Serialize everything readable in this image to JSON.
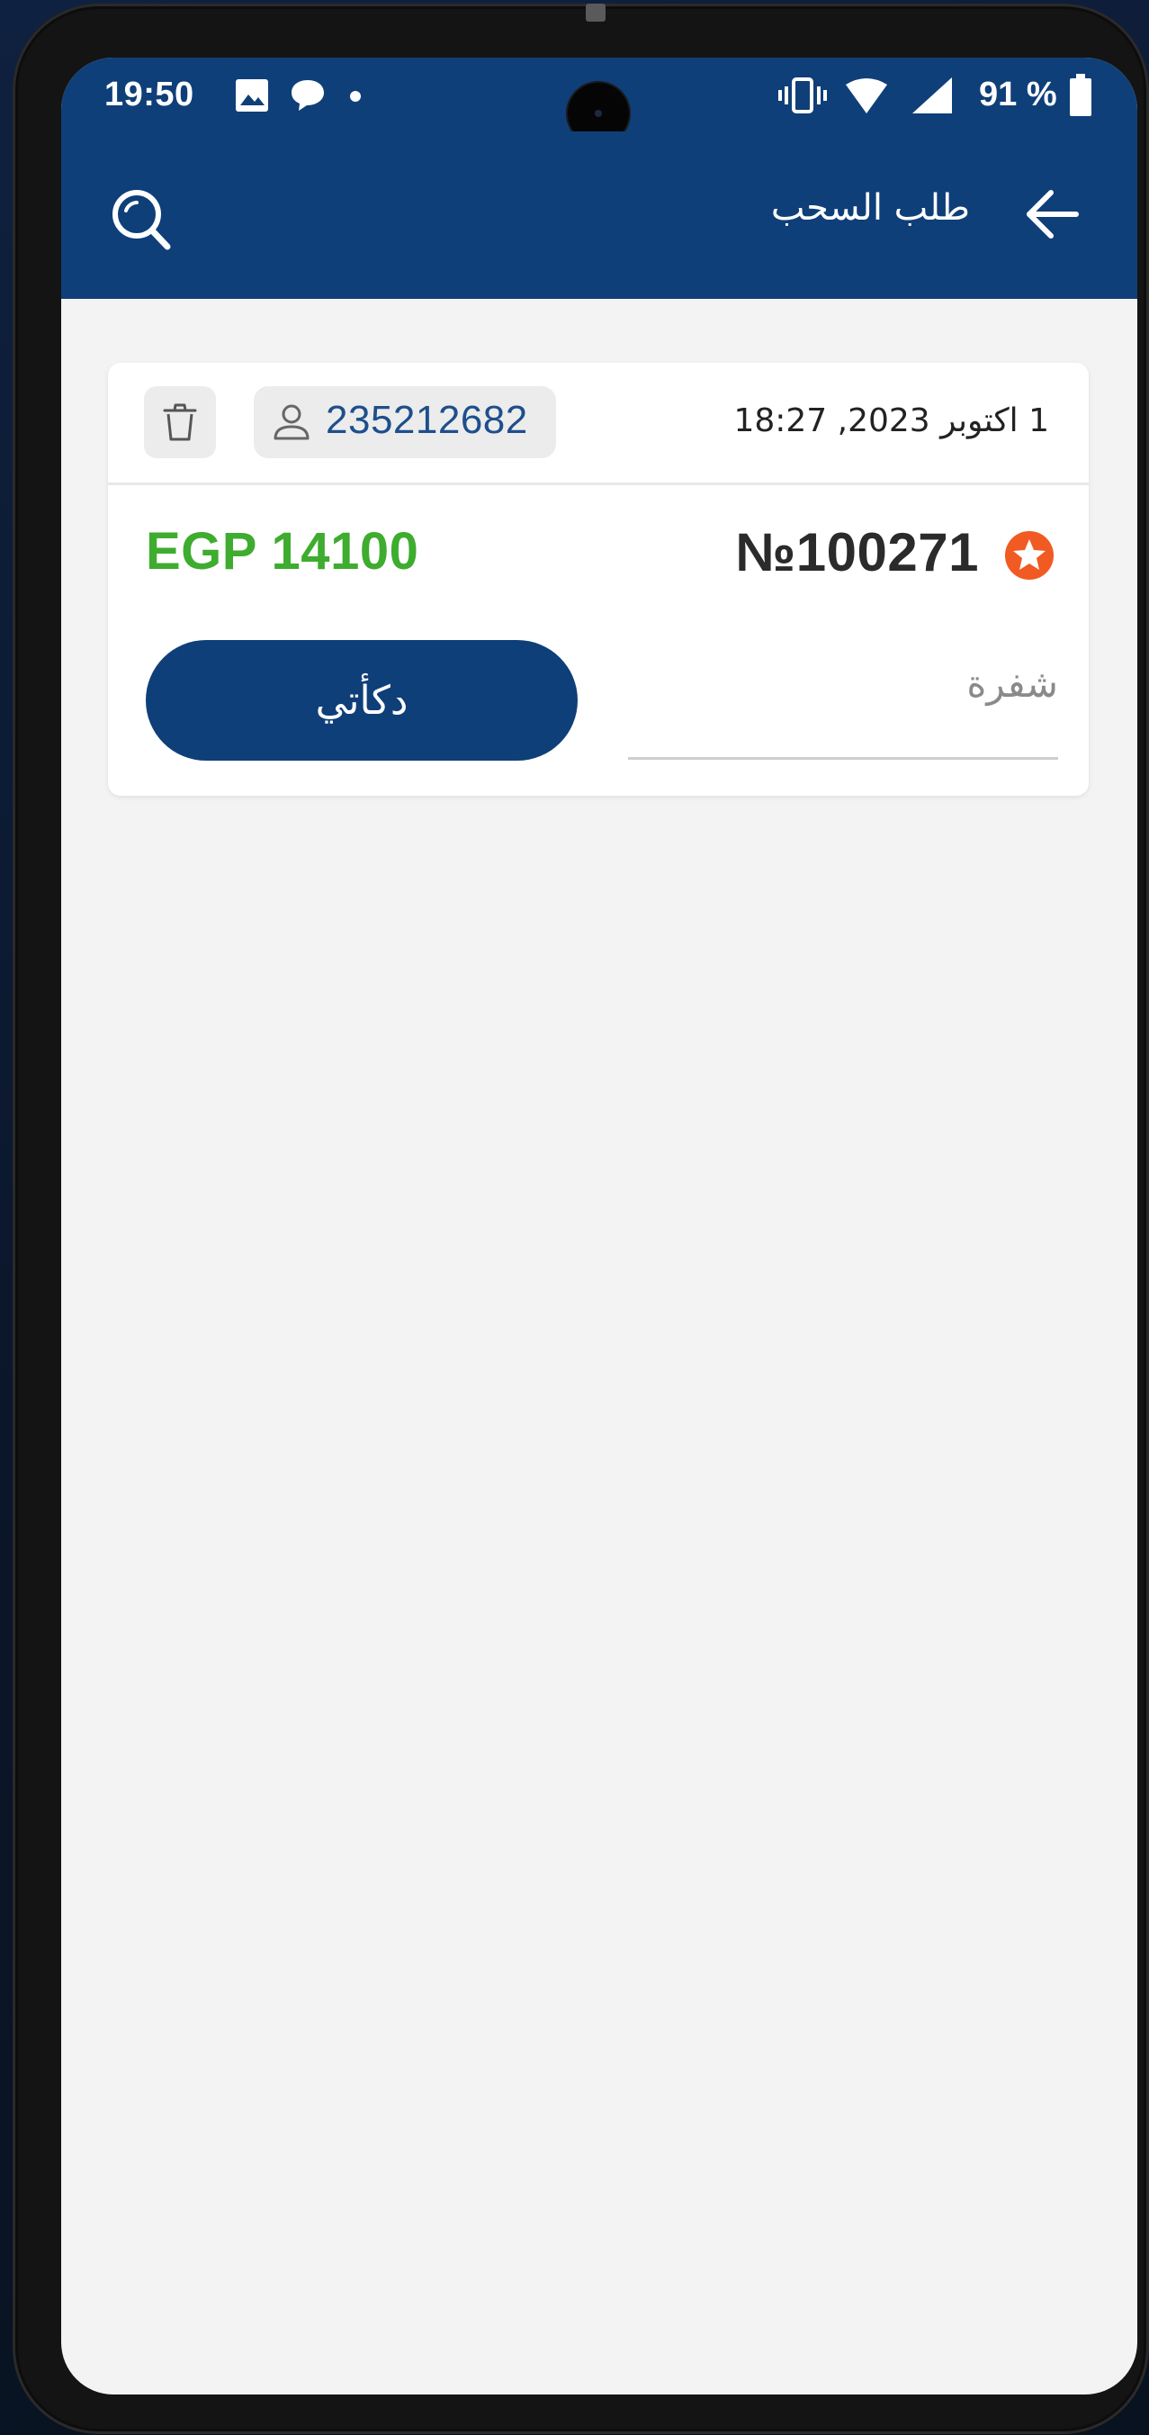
{
  "status_bar": {
    "time": "19:50",
    "battery": "91 %",
    "icons": [
      "image-icon",
      "chat-icon",
      "dot-icon",
      "vibrate-icon",
      "wifi-icon",
      "signal-icon",
      "battery-icon"
    ]
  },
  "app_bar": {
    "title": "طلب السحب",
    "back_icon": "arrow-back-icon",
    "search_icon": "search-icon"
  },
  "request_card": {
    "date": "1 اكتوبر 2023, 18:27",
    "user_id": "235212682",
    "order_number": "№100271",
    "amount": "EGP 14100",
    "action_label": "دكأتي",
    "code_placeholder": "شفرة"
  },
  "colors": {
    "primary": "#0f3f79",
    "amount": "#3eac2e",
    "badge": "#f15a22",
    "background": "#f3f3f3"
  }
}
